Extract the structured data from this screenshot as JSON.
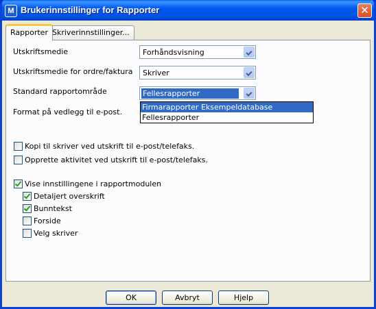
{
  "window": {
    "title": "Brukerinnstillinger for Rapporter",
    "app_icon": "M",
    "close_glyph": "✕"
  },
  "tabs": [
    {
      "label": "Rapporter"
    },
    {
      "label": "Skriverinnstillinger..."
    }
  ],
  "fields": {
    "utskriftsmedie": {
      "label": "Utskriftsmedie",
      "value": "Forhåndsvisning"
    },
    "ordre": {
      "label": "Utskriftsmedie for ordre/faktura",
      "value": "Skriver"
    },
    "omrade": {
      "label": "Standard rapportområde",
      "value": "Fellesrapporter",
      "options": [
        "Firmarapporter Eksempeldatabase",
        "Fellesrapporter"
      ],
      "highlighted": "Firmarapporter Eksempeldatabase"
    },
    "format": {
      "label": "Format på vedlegg til e-post."
    }
  },
  "checkboxes": {
    "kopi": {
      "label": "Kopi til skriver ved utskrift til e-post/telefaks.",
      "checked": false
    },
    "aktivitet": {
      "label": "Opprette aktivitet ved utskrift til e-post/telefaks.",
      "checked": false
    },
    "vise": {
      "label": "Vise innstillingene i rapportmodulen",
      "checked": true
    },
    "detaljert": {
      "label": "Detaljert overskrift",
      "checked": true
    },
    "bunntekst": {
      "label": "Bunntekst",
      "checked": true
    },
    "forside": {
      "label": "Forside",
      "checked": false
    },
    "velg": {
      "label": "Velg skriver",
      "checked": false
    }
  },
  "buttons": {
    "ok": "OK",
    "avbryt": "Avbryt",
    "hjelp": "Hjelp"
  },
  "colors": {
    "titlebar": "#0054e3",
    "dialog_bg": "#ece9d8",
    "selection": "#316ac5",
    "check": "#21a121"
  }
}
